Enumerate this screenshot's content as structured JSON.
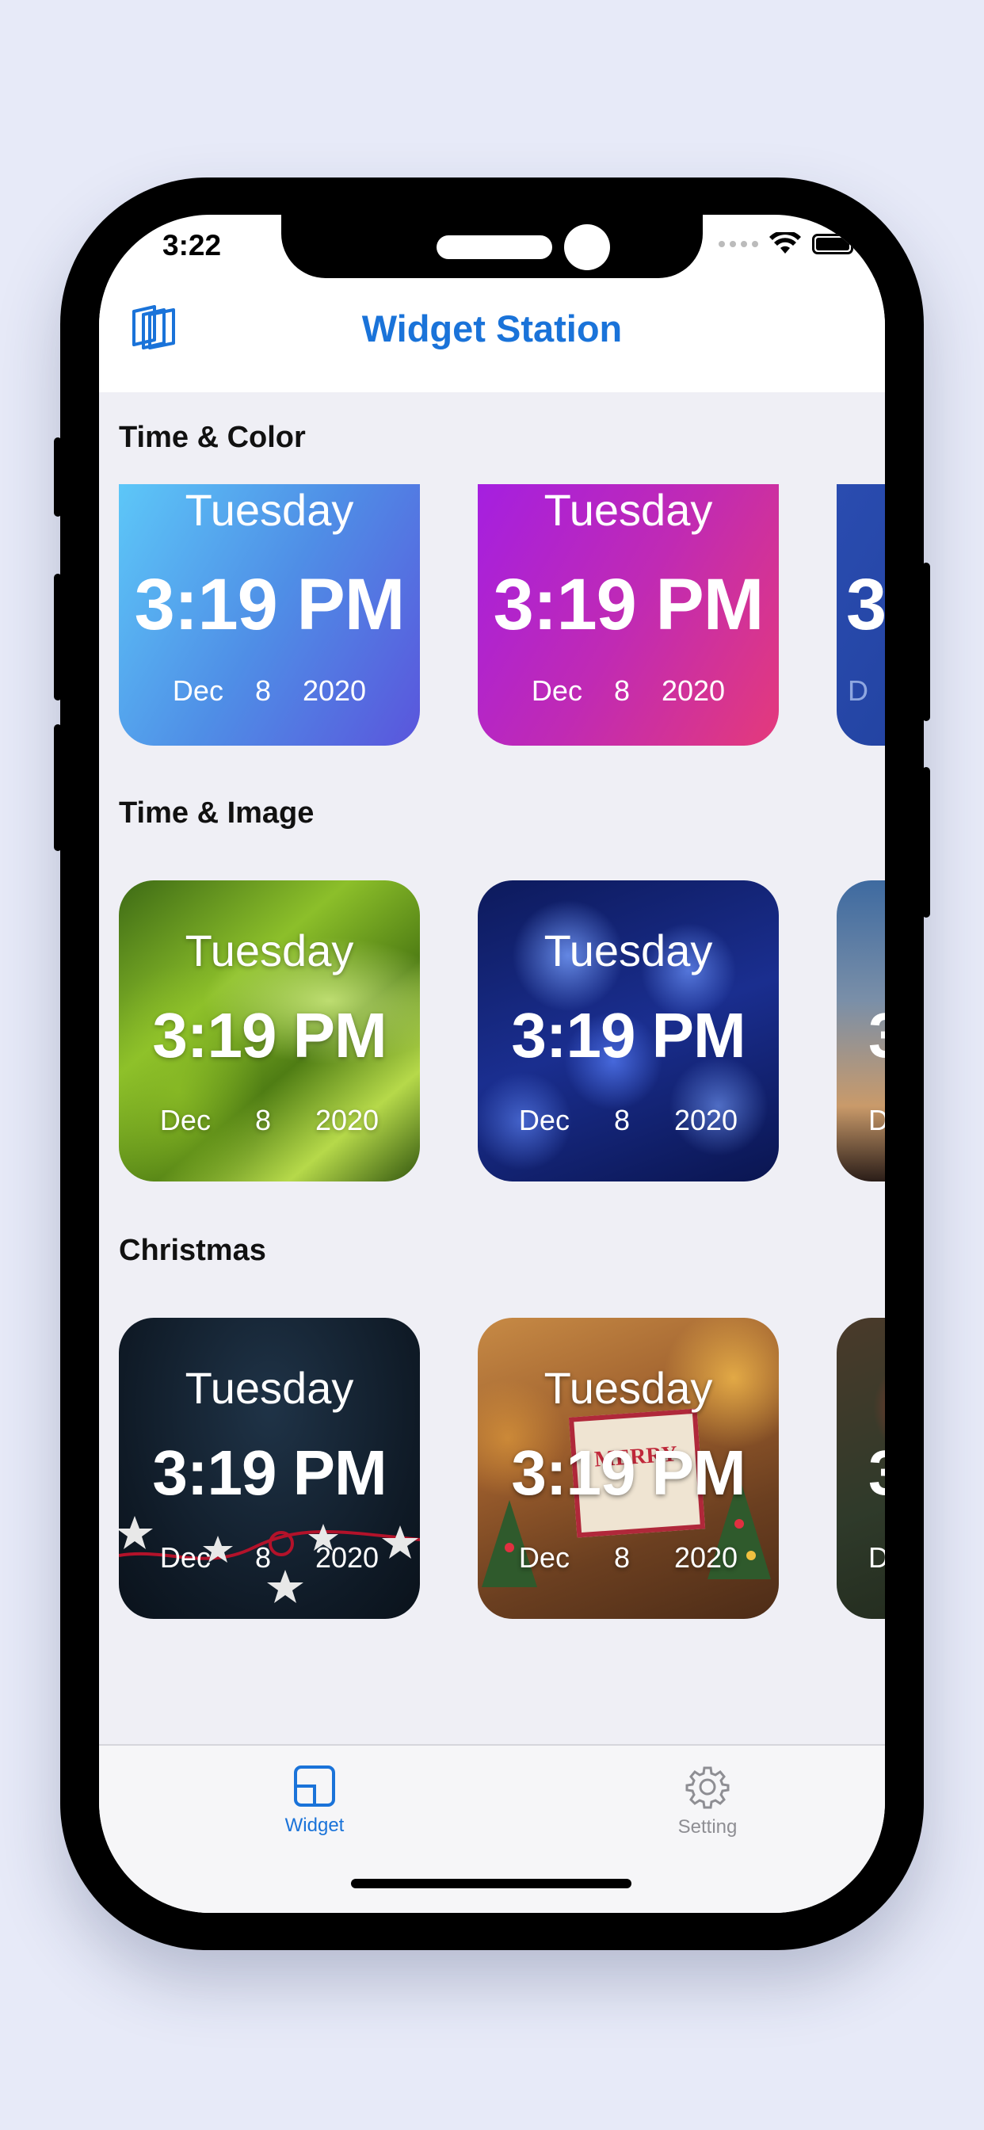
{
  "status_bar": {
    "time": "3:22"
  },
  "nav": {
    "title": "Widget Station",
    "logo_icon": "stacked-cards-icon"
  },
  "colors": {
    "accent": "#1a73d9",
    "tab_inactive": "#8e8e93"
  },
  "sections": [
    {
      "title": "Time & Color",
      "widgets": [
        {
          "day": "Tuesday",
          "time": "3:19 PM",
          "month": "Dec",
          "day_num": "8",
          "year": "2020",
          "style": "gradient-blue-violet"
        },
        {
          "day": "Tuesday",
          "time": "3:19 PM",
          "month": "Dec",
          "day_num": "8",
          "year": "2020",
          "style": "gradient-purple-pink"
        },
        {
          "day": "",
          "time": "3",
          "month": "D",
          "day_num": "",
          "year": "",
          "style": "gradient-navy"
        }
      ]
    },
    {
      "title": "Time & Image",
      "widgets": [
        {
          "day": "Tuesday",
          "time": "3:19 PM",
          "month": "Dec",
          "day_num": "8",
          "year": "2020",
          "style": "image-green-leaves"
        },
        {
          "day": "Tuesday",
          "time": "3:19 PM",
          "month": "Dec",
          "day_num": "8",
          "year": "2020",
          "style": "image-jellyfish"
        },
        {
          "day": "",
          "time": "3",
          "month": "D",
          "day_num": "",
          "year": "",
          "style": "image-sunset"
        }
      ]
    },
    {
      "title": "Christmas",
      "widgets": [
        {
          "day": "Tuesday",
          "time": "3:19 PM",
          "month": "Dec",
          "day_num": "8",
          "year": "2020",
          "style": "image-stars-dark"
        },
        {
          "day": "Tuesday",
          "time": "3:19 PM",
          "month": "Dec",
          "day_num": "8",
          "year": "2020",
          "style": "image-christmas-shop",
          "sign": "MERRY"
        },
        {
          "day": "",
          "time": "3",
          "month": "D",
          "day_num": "",
          "year": "",
          "style": "image-pine-ornaments"
        }
      ]
    }
  ],
  "tab_bar": {
    "tabs": [
      {
        "label": "Widget",
        "icon": "widget-icon",
        "active": true
      },
      {
        "label": "Setting",
        "icon": "gear-icon",
        "active": false
      }
    ]
  }
}
